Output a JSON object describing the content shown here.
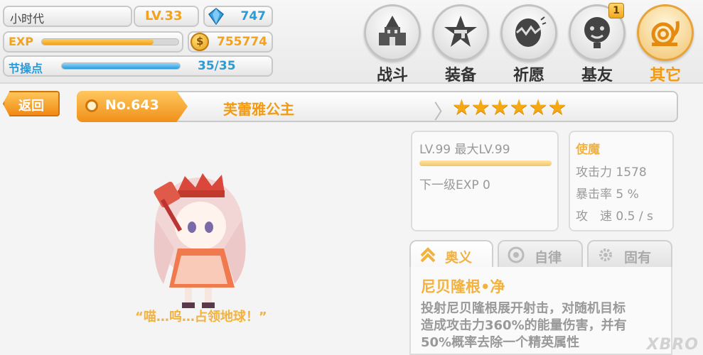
{
  "player": {
    "name": "小时代",
    "level": "LV.33",
    "gems": "747",
    "exp_label": "EXP",
    "exp_progress": 0.82,
    "coins": "755774",
    "stamina_label": "节操点",
    "stamina_progress": 1.0,
    "stamina_value": "35/35"
  },
  "nav": {
    "battle": "战斗",
    "equip": "装备",
    "pray": "祈愿",
    "friends": "基友",
    "friends_badge": "1",
    "other": "其它"
  },
  "detail": {
    "back": "返回",
    "number": "No.643",
    "name": "芙蕾雅公主",
    "stars": "★★★★★★",
    "quote": "“喵…呜…占领地球！”"
  },
  "level_card": {
    "level": "LV.99 最大LV.99",
    "next_exp": "下一级EXP 0"
  },
  "stats": {
    "class": "使魔",
    "attack": "攻击力 1578",
    "crit": "暴击率 5 %",
    "speed": "攻　速 0.5 / s"
  },
  "tabs": {
    "skill": "奥义",
    "auto": "自律",
    "passive": "固有"
  },
  "skill": {
    "name": "尼贝隆根•净",
    "line1": "投射尼贝隆根展开射击，对随机目标",
    "line2": "造成攻击力360%的能量伤害，并有",
    "line3": "50%概率去除一个精英属性"
  },
  "watermark": "XBRO",
  "colors": {
    "accent_orange": "#f29a12",
    "accent_blue": "#2b9bd6",
    "star_gold": "#f3a814"
  }
}
